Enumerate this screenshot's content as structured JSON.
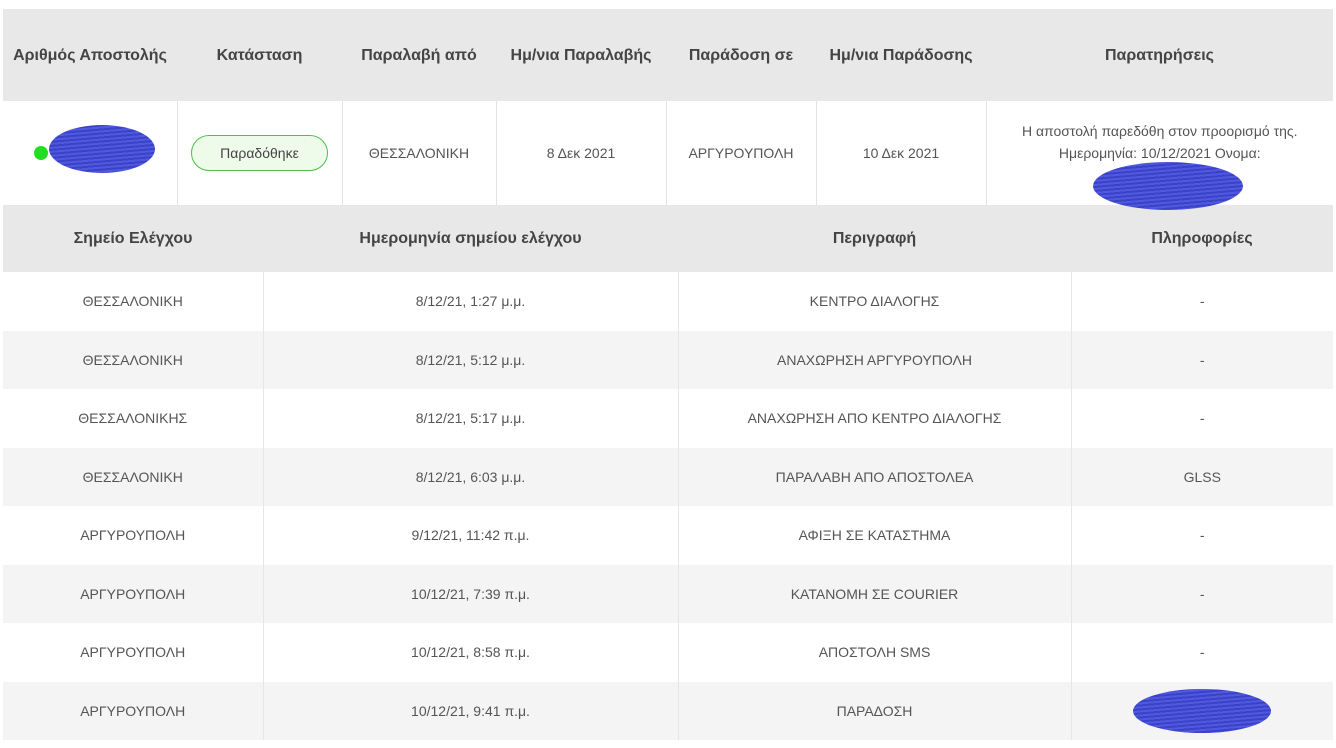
{
  "summary": {
    "headers": {
      "tracking_number": "Αριθμός Αποστολής",
      "status": "Κατάσταση",
      "pickup_from": "Παραλαβή από",
      "pickup_date": "Ημ/νια Παραλαβής",
      "delivery_to": "Παράδοση σε",
      "delivery_date": "Ημ/νια Παράδοσης",
      "notes": "Παρατηρήσεις"
    },
    "row": {
      "status_label": "Παραδόθηκε",
      "pickup_from": "ΘΕΣΣΑΛΟΝΙΚΗ",
      "pickup_date": "8 Δεκ 2021",
      "delivery_to": "ΑΡΓΥΡΟΥΠΟΛΗ",
      "delivery_date": "10 Δεκ 2021",
      "notes_line1": "Η αποστολή παρεδόθη στον προορισμό της.",
      "notes_line2": "Ημερομηνία: 10/12/2021 Ονομα:"
    },
    "status_color": "#4cc04c",
    "dot_color": "#22dd22"
  },
  "tracking": {
    "headers": {
      "checkpoint": "Σημείο Ελέγχου",
      "checkpoint_date": "Ημερομηνία σημείου ελέγχου",
      "description": "Περιγραφή",
      "info": "Πληροφορίες"
    },
    "rows": [
      {
        "checkpoint": "ΘΕΣΣΑΛΟΝΙΚΗ",
        "date": "8/12/21, 1:27 μ.μ.",
        "description": "ΚΕΝΤΡΟ ΔΙΑΛΟΓΗΣ",
        "info": "-"
      },
      {
        "checkpoint": "ΘΕΣΣΑΛΟΝΙΚΗ",
        "date": "8/12/21, 5:12 μ.μ.",
        "description": "ΑΝΑΧΩΡΗΣΗ ΑΡΓΥΡΟΥΠΟΛΗ",
        "info": "-"
      },
      {
        "checkpoint": "ΘΕΣΣΑΛΟΝΙΚΗΣ",
        "date": "8/12/21, 5:17 μ.μ.",
        "description": "ΑΝΑΧΩΡΗΣΗ ΑΠΟ ΚΕΝΤΡΟ ΔΙΑΛΟΓΗΣ",
        "info": "-"
      },
      {
        "checkpoint": "ΘΕΣΣΑΛΟΝΙΚΗ",
        "date": "8/12/21, 6:03 μ.μ.",
        "description": "ΠΑΡΑΛΑΒΗ ΑΠΟ ΑΠΟΣΤΟΛΕΑ",
        "info": "GLSS"
      },
      {
        "checkpoint": "ΑΡΓΥΡΟΥΠΟΛΗ",
        "date": "9/12/21, 11:42 π.μ.",
        "description": "ΑΦΙΞΗ ΣΕ ΚΑΤΑΣΤΗΜΑ",
        "info": "-"
      },
      {
        "checkpoint": "ΑΡΓΥΡΟΥΠΟΛΗ",
        "date": "10/12/21, 7:39 π.μ.",
        "description": "ΚΑΤΑΝΟΜΗ ΣΕ COURIER",
        "info": "-"
      },
      {
        "checkpoint": "ΑΡΓΥΡΟΥΠΟΛΗ",
        "date": "10/12/21, 8:58 π.μ.",
        "description": "ΑΠΟΣΤΟΛΗ SMS",
        "info": "-"
      },
      {
        "checkpoint": "ΑΡΓΥΡΟΥΠΟΛΗ",
        "date": "10/12/21, 9:41 π.μ.",
        "description": "ΠΑΡΑΔΟΣΗ",
        "info": ""
      }
    ]
  }
}
